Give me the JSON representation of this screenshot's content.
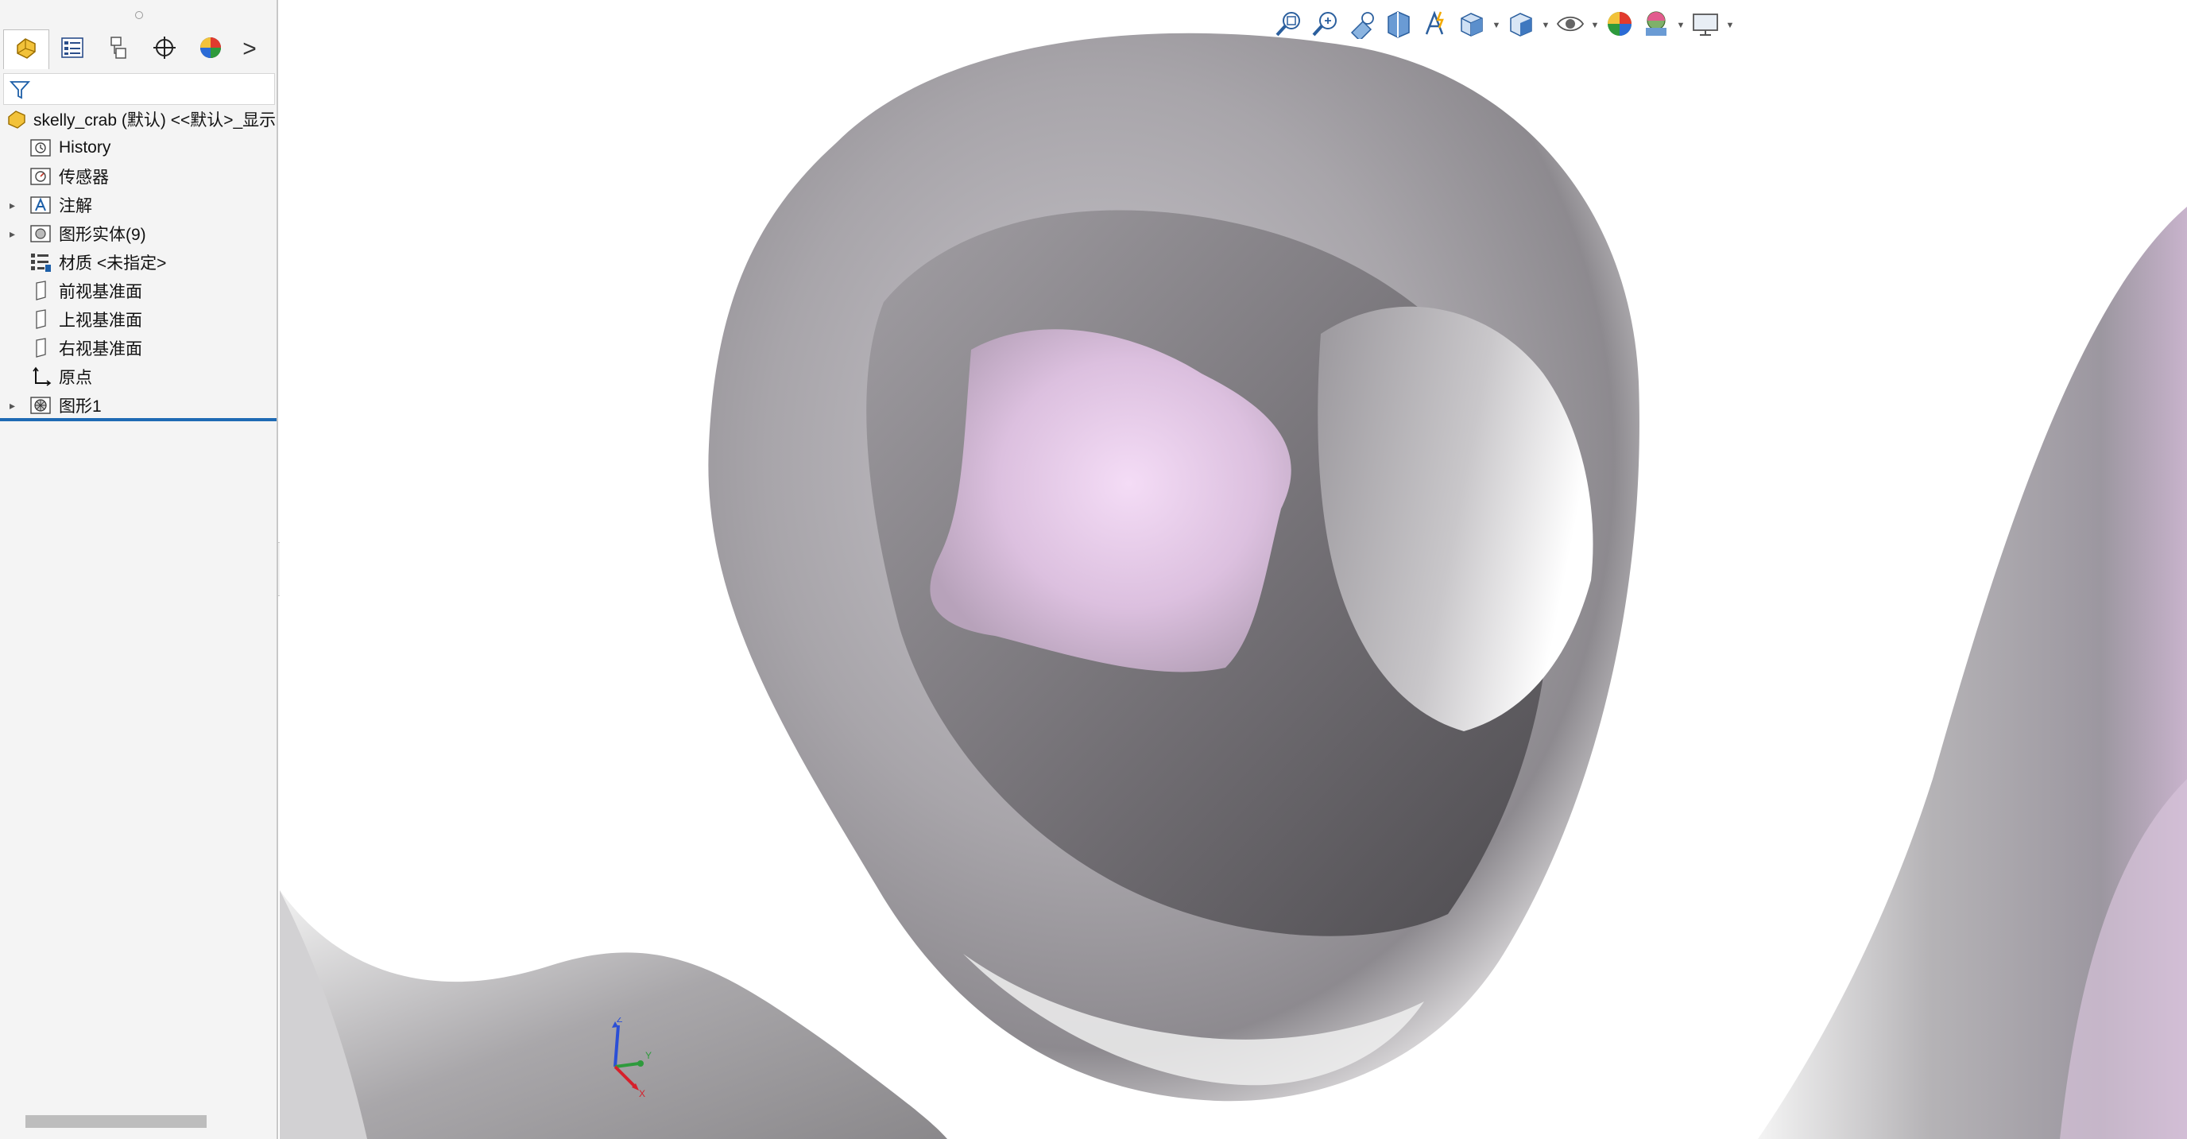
{
  "feature_manager": {
    "tabs": [
      {
        "icon": "featuremanager-icon",
        "active": true
      },
      {
        "icon": "propertymanager-icon",
        "active": false
      },
      {
        "icon": "configurationmanager-icon",
        "active": false
      },
      {
        "icon": "dimxpertmanager-icon",
        "active": false
      },
      {
        "icon": "displaymanager-icon",
        "active": false
      }
    ],
    "more_tabs_glyph": ">",
    "tree": {
      "root_label": "skelly_crab (默认) <<默认>_显示",
      "items": [
        {
          "label": "History",
          "icon": "history-folder-icon",
          "expandable": false
        },
        {
          "label": "传感器",
          "icon": "sensors-icon",
          "expandable": false
        },
        {
          "label": "注解",
          "icon": "annotations-icon",
          "expandable": true
        },
        {
          "label": "图形实体(9)",
          "icon": "graphics-bodies-icon",
          "expandable": true
        },
        {
          "label": "材质 <未指定>",
          "icon": "material-icon",
          "expandable": false
        },
        {
          "label": "前视基准面",
          "icon": "plane-icon",
          "expandable": false
        },
        {
          "label": "上视基准面",
          "icon": "plane-icon",
          "expandable": false
        },
        {
          "label": "右视基准面",
          "icon": "plane-icon",
          "expandable": false
        },
        {
          "label": "原点",
          "icon": "origin-icon",
          "expandable": false
        },
        {
          "label": "图形1",
          "icon": "mesh-body-icon",
          "expandable": true
        }
      ]
    }
  },
  "heads_up_toolbar": [
    {
      "icon": "zoom-to-fit-icon",
      "dropdown": false
    },
    {
      "icon": "zoom-to-area-icon",
      "dropdown": false
    },
    {
      "icon": "previous-view-icon",
      "dropdown": false
    },
    {
      "icon": "section-view-icon",
      "dropdown": false
    },
    {
      "icon": "dynamic-annotation-icon",
      "dropdown": false
    },
    {
      "icon": "view-orientation-icon",
      "dropdown": true
    },
    {
      "icon": "display-style-icon",
      "dropdown": true
    },
    {
      "icon": "hide-show-items-icon",
      "dropdown": true
    },
    {
      "icon": "edit-appearance-icon",
      "dropdown": false
    },
    {
      "icon": "apply-scene-icon",
      "dropdown": true
    },
    {
      "icon": "view-settings-icon",
      "dropdown": true
    }
  ],
  "triad": {
    "x": "X",
    "y": "Y",
    "z": "Z"
  },
  "colors": {
    "selection_blue": "#1e6ab4",
    "panel_bg": "#f4f4f4",
    "mesh_gray": "#a5a3a6",
    "mesh_pink": "#f0d6f2"
  }
}
